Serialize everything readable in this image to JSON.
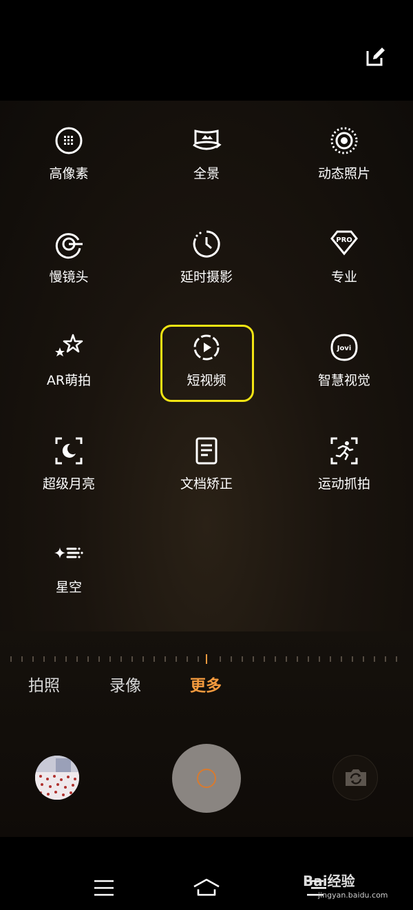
{
  "modes": [
    {
      "label": "高像素",
      "icon": "high-pixel-icon"
    },
    {
      "label": "全景",
      "icon": "panorama-icon"
    },
    {
      "label": "动态照片",
      "icon": "live-photo-icon"
    },
    {
      "label": "慢镜头",
      "icon": "slow-motion-icon"
    },
    {
      "label": "延时摄影",
      "icon": "time-lapse-icon"
    },
    {
      "label": "专业",
      "icon": "pro-icon"
    },
    {
      "label": "AR萌拍",
      "icon": "ar-stars-icon"
    },
    {
      "label": "短视频",
      "icon": "short-video-icon"
    },
    {
      "label": "智慧视觉",
      "icon": "jovi-icon",
      "icon_text": "Jovi"
    },
    {
      "label": "超级月亮",
      "icon": "super-moon-icon"
    },
    {
      "label": "文档矫正",
      "icon": "document-icon"
    },
    {
      "label": "运动抓拍",
      "icon": "sport-capture-icon"
    },
    {
      "label": "星空",
      "icon": "starry-sky-icon"
    }
  ],
  "pro_icon_text": "PRO",
  "tabs": {
    "photo": "拍照",
    "video": "录像",
    "more": "更多"
  },
  "colors": {
    "accent": "#f39a3e",
    "highlight": "#f2e413"
  },
  "watermark": {
    "brand": "Bai经验",
    "url": "jingyan.baidu.com"
  }
}
